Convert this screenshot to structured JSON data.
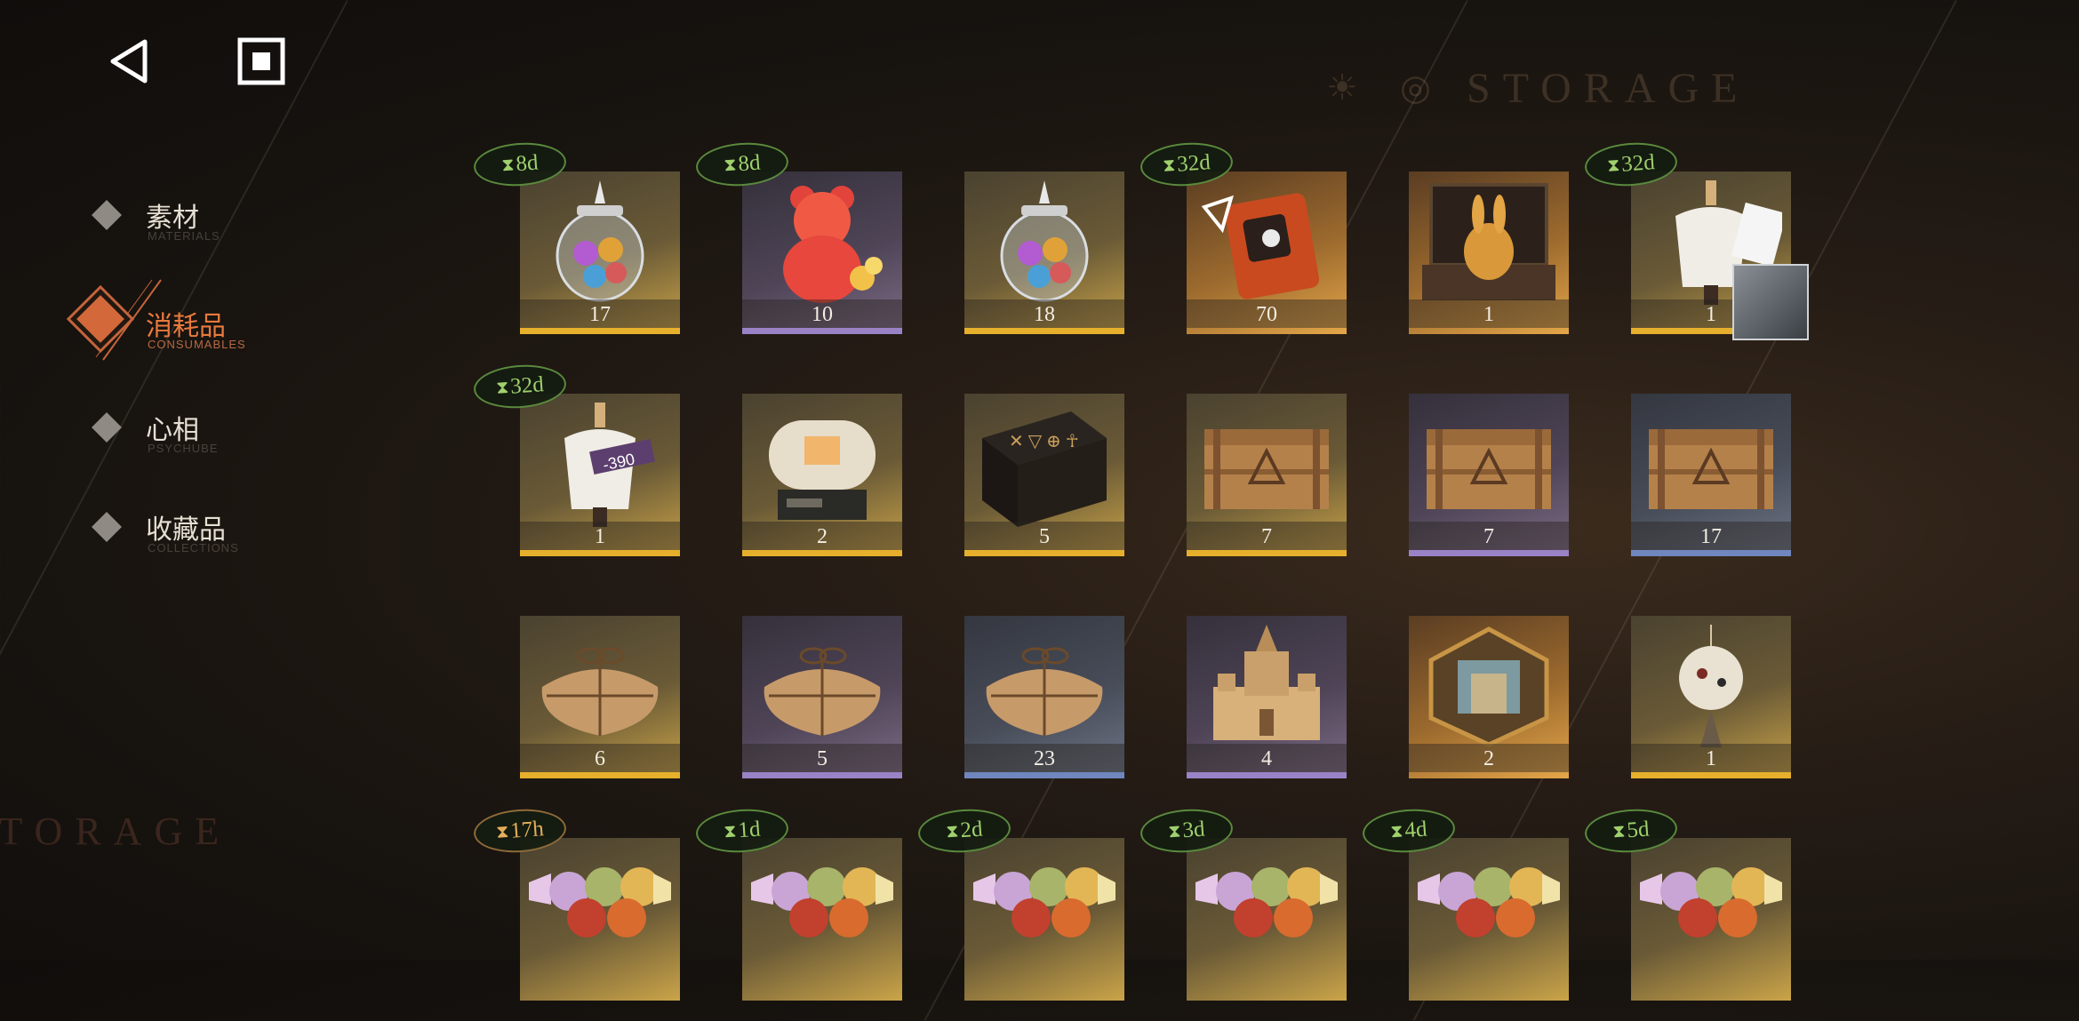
{
  "header": {
    "watermark_top": "STORAGE",
    "watermark_bottom": "STORAGE"
  },
  "nav": {
    "back_icon": "triangle-back-icon",
    "home_icon": "square-home-icon"
  },
  "sidebar": {
    "items": [
      {
        "label": "素材",
        "sub": "MATERIALS",
        "active": false
      },
      {
        "label": "消耗品",
        "sub": "CONSUMABLES",
        "active": true
      },
      {
        "label": "心相",
        "sub": "PSYCHUBE",
        "active": false
      },
      {
        "label": "收藏品",
        "sub": "COLLECTIONS",
        "active": false
      }
    ]
  },
  "colors": {
    "accent": "#e87a3e",
    "timer_green": "#9fd06d",
    "timer_orange": "#e5ad5a",
    "rarity_gold": "#e6b02c",
    "rarity_purple": "#9a82c7",
    "rarity_blue": "#6f86be"
  },
  "items": [
    {
      "name": "jar-of-candies-icon",
      "count": "17",
      "rarity": "gold",
      "timer": "8d"
    },
    {
      "name": "red-gummy-bear-icon",
      "count": "10",
      "rarity": "purple",
      "timer": "8d"
    },
    {
      "name": "jar-of-candies-icon",
      "count": "18",
      "rarity": "gold",
      "timer": ""
    },
    {
      "name": "orange-device-icon",
      "count": "70",
      "rarity": "orange",
      "timer": "32d"
    },
    {
      "name": "golden-rabbit-box-icon",
      "count": "1",
      "rarity": "orange",
      "timer": ""
    },
    {
      "name": "mannequin-with-portrait-icon",
      "count": "1",
      "rarity": "gold",
      "timer": "32d"
    },
    {
      "name": "mannequin-coupon-icon",
      "count": "1",
      "rarity": "gold",
      "timer": "32d"
    },
    {
      "name": "capsule-machine-icon",
      "count": "2",
      "rarity": "gold",
      "timer": ""
    },
    {
      "name": "rune-chest-icon",
      "count": "5",
      "rarity": "gold",
      "timer": ""
    },
    {
      "name": "wooden-crate-icon",
      "count": "7",
      "rarity": "gold",
      "timer": ""
    },
    {
      "name": "wooden-crate-icon",
      "count": "7",
      "rarity": "purple",
      "timer": ""
    },
    {
      "name": "wooden-crate-icon",
      "count": "17",
      "rarity": "blue",
      "timer": ""
    },
    {
      "name": "paper-parcel-icon",
      "count": "6",
      "rarity": "gold",
      "timer": ""
    },
    {
      "name": "paper-parcel-icon",
      "count": "5",
      "rarity": "purple",
      "timer": ""
    },
    {
      "name": "paper-parcel-icon",
      "count": "23",
      "rarity": "blue",
      "timer": ""
    },
    {
      "name": "sand-castle-icon",
      "count": "4",
      "rarity": "purple",
      "timer": ""
    },
    {
      "name": "hexagon-badge-icon",
      "count": "2",
      "rarity": "orange",
      "timer": ""
    },
    {
      "name": "hanging-ornament-icon",
      "count": "1",
      "rarity": "gold",
      "timer": ""
    },
    {
      "name": "wrapped-candies-icon",
      "count": "",
      "rarity": "gold",
      "timer": "17h"
    },
    {
      "name": "wrapped-candies-icon",
      "count": "",
      "rarity": "gold",
      "timer": "1d"
    },
    {
      "name": "wrapped-candies-icon",
      "count": "",
      "rarity": "gold",
      "timer": "2d"
    },
    {
      "name": "wrapped-candies-icon",
      "count": "",
      "rarity": "gold",
      "timer": "3d"
    },
    {
      "name": "wrapped-candies-icon",
      "count": "",
      "rarity": "gold",
      "timer": "4d"
    },
    {
      "name": "wrapped-candies-icon",
      "count": "",
      "rarity": "gold",
      "timer": "5d"
    }
  ]
}
